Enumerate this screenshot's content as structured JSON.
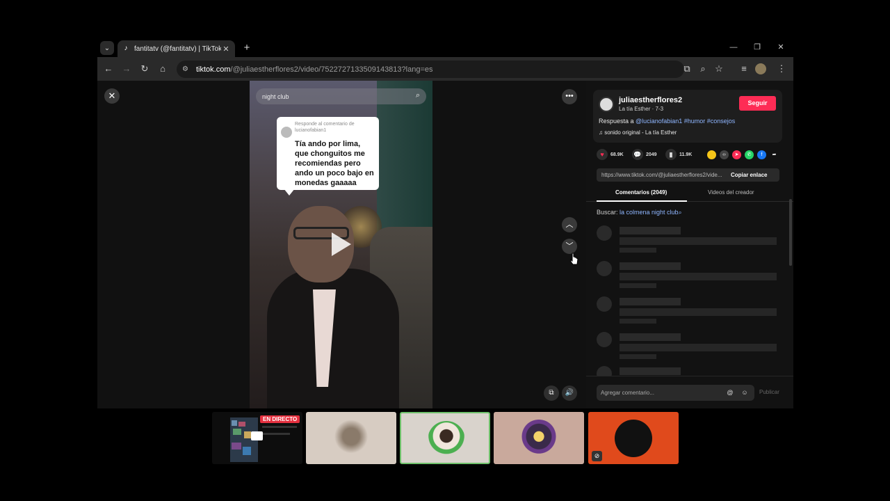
{
  "browser": {
    "tab_title": "fantitatv (@fantitatv) | TikTok",
    "url_domain": "tiktok.com",
    "url_path": "/@juliaestherflores2/video/7522727133509143813?lang=es"
  },
  "video": {
    "search_text": "night club",
    "reply_card": {
      "meta": "Responde al comentario de lucianofabian1",
      "text": "Tía ando por lima, que chonguitos me recomiendas pero ando un poco bajo en monedas gaaaaa"
    }
  },
  "panel": {
    "author_name": "juliaestherflores2",
    "author_sub": "La tía Esther · 7-3",
    "follow_label": "Seguir",
    "caption_prefix": "Respuesta a ",
    "caption_mention": "@lucianofabian1",
    "caption_tags": " #humor #consejos",
    "sound": "sonido original - La tía Esther",
    "likes": "68.9K",
    "comments": "2049",
    "saves": "11.9K",
    "share_url": "https://www.tiktok.com/@juliaestherflores2/vide...",
    "copy_label": "Copiar enlace",
    "tab_comments": "Comentarios (2049)",
    "tab_videos": "Videos del creador",
    "buscar_label": "Buscar: ",
    "buscar_query": "la colmena night club",
    "comment_placeholder": "Agregar comentario...",
    "publish_label": "Publicar"
  },
  "participants": {
    "live_label": "EN DIRECTO"
  }
}
